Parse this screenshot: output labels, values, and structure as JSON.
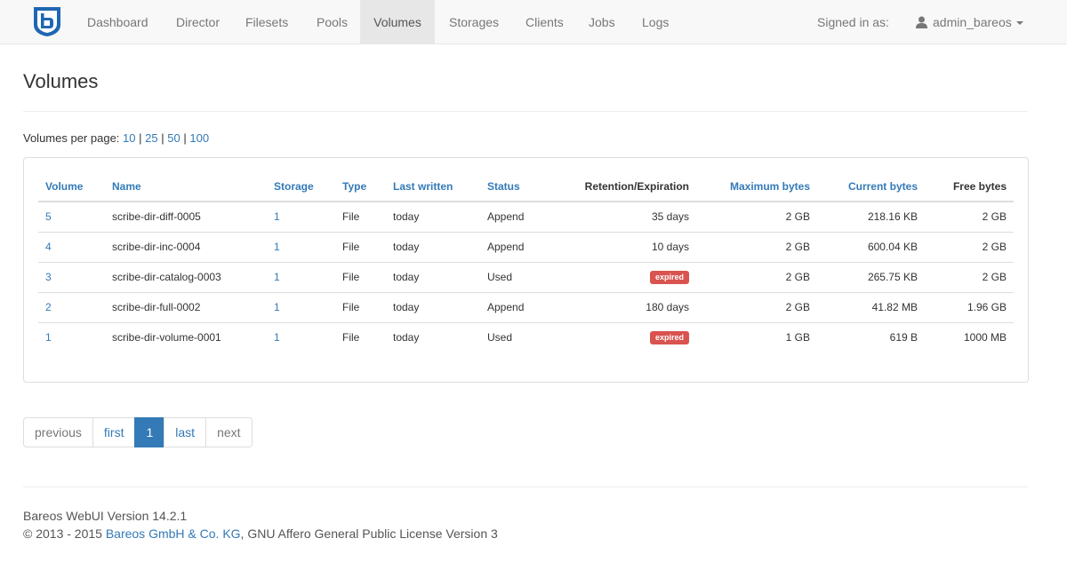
{
  "nav": {
    "items": [
      {
        "label": "Dashboard",
        "active": false
      },
      {
        "label": "Director",
        "active": false
      },
      {
        "label": "Filesets",
        "active": false
      },
      {
        "label": "Pools",
        "active": false
      },
      {
        "label": "Volumes",
        "active": true
      },
      {
        "label": "Storages",
        "active": false
      },
      {
        "label": "Clients",
        "active": false
      },
      {
        "label": "Jobs",
        "active": false
      },
      {
        "label": "Logs",
        "active": false
      }
    ],
    "signed_in_label": "Signed in as:",
    "username": "admin_bareos",
    "logo_letter": "b",
    "logo_color": "#1f66b3"
  },
  "page": {
    "title": "Volumes",
    "per_page_label": "Volumes per page:",
    "per_page_options": [
      "10",
      "25",
      "50",
      "100"
    ],
    "separator": "|"
  },
  "table": {
    "headers": [
      "Volume",
      "Name",
      "Storage",
      "Type",
      "Last written",
      "Status",
      "Retention/Expiration",
      "Maximum bytes",
      "Current bytes",
      "Free bytes"
    ],
    "rows": [
      {
        "volume": "5",
        "name": "scribe-dir-diff-0005",
        "storage": "1",
        "type": "File",
        "last_written": "today",
        "status": "Append",
        "retention": "35 days",
        "expired": false,
        "max_bytes": "2 GB",
        "current_bytes": "218.16 KB",
        "free_bytes": "2 GB"
      },
      {
        "volume": "4",
        "name": "scribe-dir-inc-0004",
        "storage": "1",
        "type": "File",
        "last_written": "today",
        "status": "Append",
        "retention": "10 days",
        "expired": false,
        "max_bytes": "2 GB",
        "current_bytes": "600.04 KB",
        "free_bytes": "2 GB"
      },
      {
        "volume": "3",
        "name": "scribe-dir-catalog-0003",
        "storage": "1",
        "type": "File",
        "last_written": "today",
        "status": "Used",
        "retention": "expired",
        "expired": true,
        "max_bytes": "2 GB",
        "current_bytes": "265.75 KB",
        "free_bytes": "2 GB"
      },
      {
        "volume": "2",
        "name": "scribe-dir-full-0002",
        "storage": "1",
        "type": "File",
        "last_written": "today",
        "status": "Append",
        "retention": "180 days",
        "expired": false,
        "max_bytes": "2 GB",
        "current_bytes": "41.82 MB",
        "free_bytes": "1.96 GB"
      },
      {
        "volume": "1",
        "name": "scribe-dir-volume-0001",
        "storage": "1",
        "type": "File",
        "last_written": "today",
        "status": "Used",
        "retention": "expired",
        "expired": true,
        "max_bytes": "1 GB",
        "current_bytes": "619 B",
        "free_bytes": "1000 MB"
      }
    ]
  },
  "pagination": {
    "previous": "previous",
    "first": "first",
    "current": "1",
    "last": "last",
    "next": "next"
  },
  "footer": {
    "version": "Bareos WebUI Version 14.2.1",
    "copyright_prefix": "© 2013 - 2015",
    "company": "Bareos GmbH & Co. KG",
    "license": ", GNU Affero General Public License Version 3"
  }
}
